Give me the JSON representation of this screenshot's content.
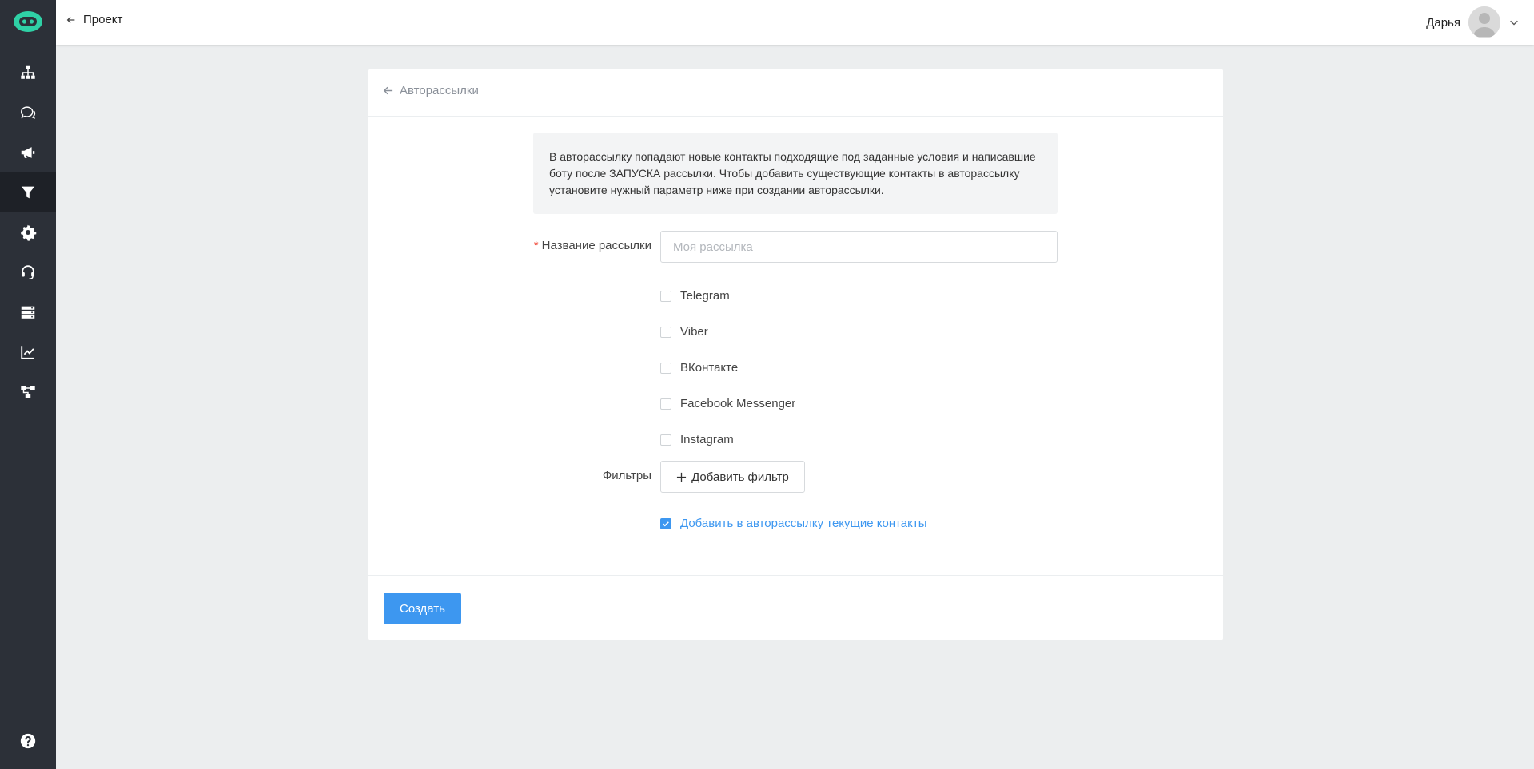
{
  "header": {
    "back_label": "Проект",
    "user_name": "Дарья"
  },
  "sidebar": {
    "items": [
      {
        "icon": "sitemap-icon"
      },
      {
        "icon": "chat-icon"
      },
      {
        "icon": "megaphone-icon"
      },
      {
        "icon": "filter-icon",
        "active": true
      },
      {
        "icon": "gear-icon"
      },
      {
        "icon": "headset-icon"
      },
      {
        "icon": "server-icon"
      },
      {
        "icon": "chart-icon"
      },
      {
        "icon": "flow-icon"
      }
    ],
    "help_icon": "help-icon"
  },
  "card": {
    "back_label": "Авторассылки",
    "info_text": "В авторассылку попадают новые контакты подходящие под заданные условия и написавшие боту после ЗАПУСКА рассылки. Чтобы добавить существующие контакты в авторассылку установите нужный параметр ниже при создании авторассылки.",
    "name_label": "Название рассылки",
    "name_required": "*",
    "name_placeholder": "Моя рассылка",
    "name_value": "",
    "channels": [
      {
        "label": "Telegram",
        "checked": false
      },
      {
        "label": "Viber",
        "checked": false
      },
      {
        "label": "ВКонтакте",
        "checked": false
      },
      {
        "label": "Facebook Messenger",
        "checked": false
      },
      {
        "label": "Instagram",
        "checked": false
      }
    ],
    "filters_label": "Фильтры",
    "add_filter_label": "Добавить фильтр",
    "add_current_label": "Добавить в авторассылку текущие контакты",
    "add_current_checked": true,
    "create_label": "Создать"
  },
  "colors": {
    "accent": "#3d97f0",
    "sidebar": "#2c3038",
    "logo": "#2fd1a6",
    "required": "#f04a3a"
  }
}
